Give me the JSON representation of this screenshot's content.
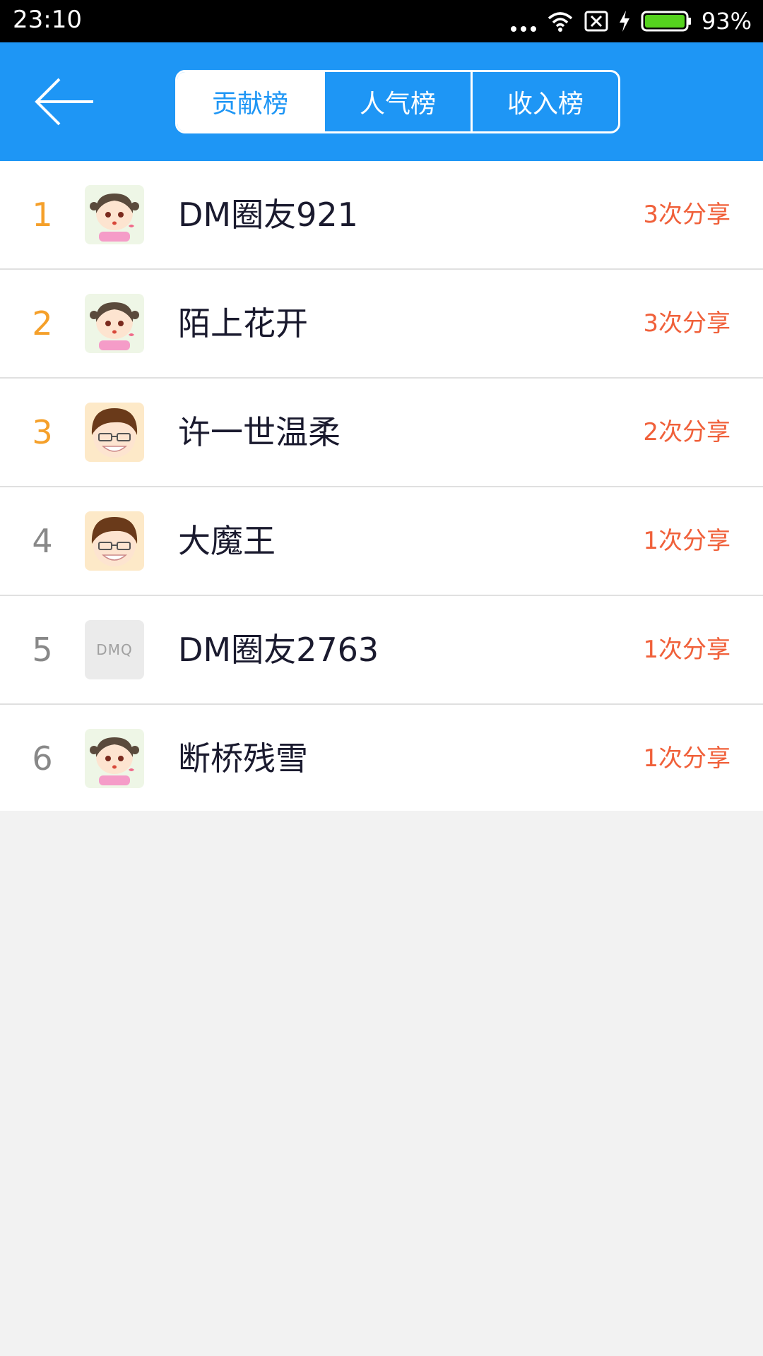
{
  "status_bar": {
    "time": "23:10",
    "battery": "93%"
  },
  "header": {
    "tabs": [
      {
        "label": "贡献榜",
        "active": true
      },
      {
        "label": "人气榜",
        "active": false
      },
      {
        "label": "收入榜",
        "active": false
      }
    ]
  },
  "ranking": [
    {
      "rank": "1",
      "name": "DM圈友921",
      "shares": "3次分享",
      "avatar": "girl-avatar-icon"
    },
    {
      "rank": "2",
      "name": "陌上花开",
      "shares": "3次分享",
      "avatar": "girl-avatar-icon"
    },
    {
      "rank": "3",
      "name": "许一世温柔",
      "shares": "2次分享",
      "avatar": "boy-glasses-avatar-icon"
    },
    {
      "rank": "4",
      "name": "大魔王",
      "shares": "1次分享",
      "avatar": "boy-glasses-avatar-icon"
    },
    {
      "rank": "5",
      "name": "DM圈友2763",
      "shares": "1次分享",
      "avatar": "DMQ"
    },
    {
      "rank": "6",
      "name": "断桥残雪",
      "shares": "1次分享",
      "avatar": "girl-avatar-icon"
    }
  ],
  "colors": {
    "header": "#1e96f5",
    "rank_top": "#f5a02a",
    "rank_normal": "#888888",
    "shares": "#f0603a"
  }
}
